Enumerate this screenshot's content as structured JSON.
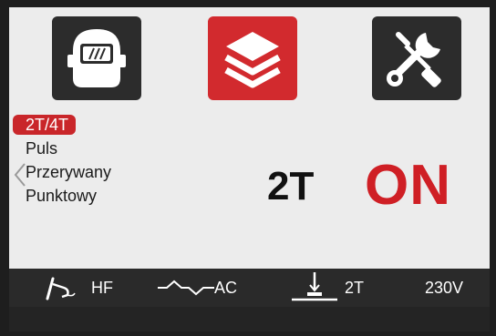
{
  "top_tiles": [
    {
      "name": "welding-helmet",
      "active": false
    },
    {
      "name": "layers",
      "active": true
    },
    {
      "name": "tools",
      "active": false
    }
  ],
  "menu": {
    "items": [
      "2T/4T",
      "Puls",
      "Przerywany",
      "Punktowy"
    ],
    "selected_index": 0
  },
  "main": {
    "mode": "2T",
    "state": "ON"
  },
  "status": {
    "hf": "HF",
    "ac": "AC",
    "trigger": "2T",
    "voltage": "230V"
  },
  "colors": {
    "accent": "#d22a2e",
    "tile_dark": "#2c2c2c",
    "screen_bg": "#ececec",
    "status_bg": "#2a2a2a"
  }
}
